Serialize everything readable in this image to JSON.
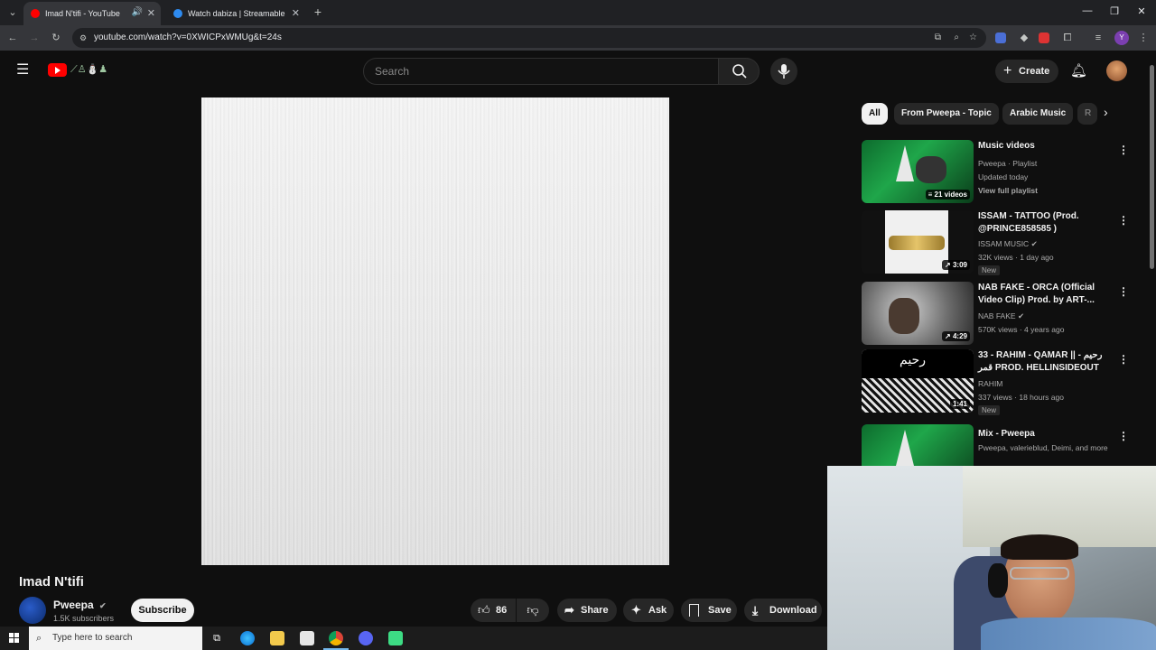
{
  "browser": {
    "tabs": [
      {
        "title": "Imad N'tifi - YouTube",
        "active": true
      },
      {
        "title": "Watch dabiza | Streamable",
        "active": false
      }
    ],
    "url": "youtube.com/watch?v=0XWICPxWMUg&t=24s"
  },
  "header": {
    "search_placeholder": "Search",
    "create_label": "Create"
  },
  "video": {
    "title": "Imad N'tifi",
    "channel": "Pweepa",
    "subscribers": "1.5K subscribers",
    "subscribe_label": "Subscribe",
    "likes": "86",
    "share_label": "Share",
    "ask_label": "Ask",
    "save_label": "Save",
    "download_label": "Download"
  },
  "chips": [
    "All",
    "From Pweepa - Topic",
    "Arabic Music",
    "R"
  ],
  "recommendations": [
    {
      "title": "Music videos",
      "channel": "Pweepa · Playlist",
      "meta1": "Updated today",
      "meta2": "View full playlist",
      "badge": "21 videos",
      "new": false
    },
    {
      "title": "ISSAM - TATTOO (Prod. @PRINCE858585 )",
      "channel": "ISSAM MUSIC",
      "meta1": "32K views · 1 day ago",
      "badge": "3:09",
      "new": true
    },
    {
      "title": "NAB FAKE - ORCA (Official Video Clip) Prod. by ART-...",
      "channel": "NAB FAKE",
      "meta1": "570K views · 4 years ago",
      "badge": "4:29",
      "new": false
    },
    {
      "title": "33 - RAHIM - QAMAR || رحيم - قمر PROD. HELLINSIDEOUT",
      "channel": "RAHIM",
      "meta1": "337 views · 18 hours ago",
      "badge": "1:41",
      "new": true
    },
    {
      "title": "Mix - Pweepa",
      "channel": "Pweepa, valerieblud, Deimi, and more",
      "meta1": "",
      "badge": "",
      "new": false
    }
  ],
  "new_label": "New",
  "taskbar": {
    "search_placeholder": "Type here to search"
  },
  "colors": {
    "youtube_red": "#ff0000",
    "background": "#0f0f0f"
  }
}
